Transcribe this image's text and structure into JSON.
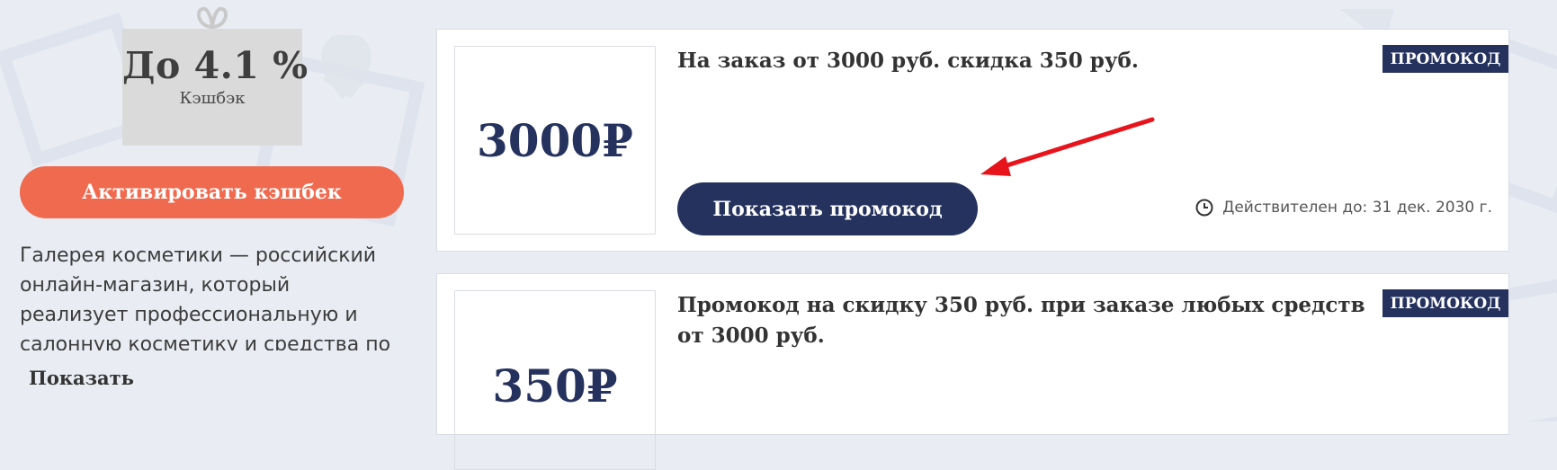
{
  "cashback": {
    "value": "До 4.1 %",
    "label": "Кэшбэк"
  },
  "activate_button": "Активировать кэшбек",
  "shop_description": "Галерея косметики — российский онлайн-магазин, который реализует профессиональную и салонную косметику и средства по",
  "show_more": "Показать",
  "coupons": [
    {
      "amount": "3000₽",
      "title": "На заказ от 3000 руб. скидка 350 руб.",
      "badge": "ПРОМОКОД",
      "button": "Показать промокод",
      "valid_until": "Действителен до: 31 дек. 2030 г."
    },
    {
      "amount": "350₽",
      "title": "Промокод на скидку 350 руб. при заказе любых средств от 3000 руб.",
      "badge": "ПРОМОКОД"
    }
  ],
  "colors": {
    "accent": "#f06a4f",
    "navy": "#25325e",
    "annotation": "#e8141c"
  }
}
